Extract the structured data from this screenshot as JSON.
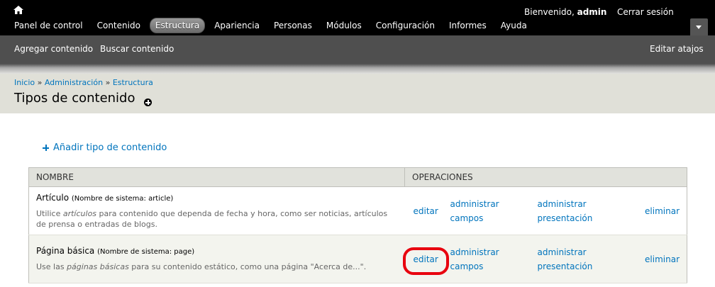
{
  "toolbar": {
    "greeting_prefix": "Bienvenido,",
    "username": "admin",
    "logout": "Cerrar sesión",
    "menu": [
      {
        "label": "Panel de control",
        "active": false
      },
      {
        "label": "Contenido",
        "active": false
      },
      {
        "label": "Estructura",
        "active": true
      },
      {
        "label": "Apariencia",
        "active": false
      },
      {
        "label": "Personas",
        "active": false
      },
      {
        "label": "Módulos",
        "active": false
      },
      {
        "label": "Configuración",
        "active": false
      },
      {
        "label": "Informes",
        "active": false
      },
      {
        "label": "Ayuda",
        "active": false
      }
    ]
  },
  "shortcuts": {
    "add_content": "Agregar contenido",
    "find_content": "Buscar contenido",
    "edit_shortcuts": "Editar atajos"
  },
  "breadcrumb": {
    "home": "Inicio",
    "admin": "Administración",
    "structure": "Estructura",
    "separator": "»"
  },
  "page": {
    "title": "Tipos de contenido",
    "add_link": "Añadir tipo de contenido"
  },
  "table": {
    "headers": {
      "name": "Nombre",
      "operations": "Operaciones"
    },
    "rows": [
      {
        "name": "Artículo",
        "machine": "(Nombre de sistema: article)",
        "desc_before": "Utilice ",
        "desc_em": "artículos",
        "desc_after": " para contenido que dependa de fecha y hora, como ser noticias, artículos de prensa o entradas de blogs.",
        "edit": "editar",
        "manage_fields_1": "administrar",
        "manage_fields_2": "campos",
        "manage_display_1": "administrar",
        "manage_display_2": "presentación",
        "delete": "eliminar"
      },
      {
        "name": "Página básica",
        "machine": "(Nombre de sistema: page)",
        "desc_before": "Use las ",
        "desc_em": "páginas básicas",
        "desc_after": " para su contenido estático, como una página \"Acerca de...\".",
        "edit": "editar",
        "manage_fields_1": "administrar",
        "manage_fields_2": "campos",
        "manage_display_1": "administrar",
        "manage_display_2": "presentación",
        "delete": "eliminar"
      }
    ]
  },
  "colors": {
    "toolbar_bg": "#000000",
    "shortcuts_bg": "#4f4f4f",
    "branding_bg": "#e0e0d8",
    "link": "#0074bd",
    "highlight_circle": "#e8000e"
  },
  "icons": {
    "home": "home-icon",
    "toggle": "chevron-down-icon",
    "help": "add-circle-icon",
    "add": "plus-icon"
  }
}
